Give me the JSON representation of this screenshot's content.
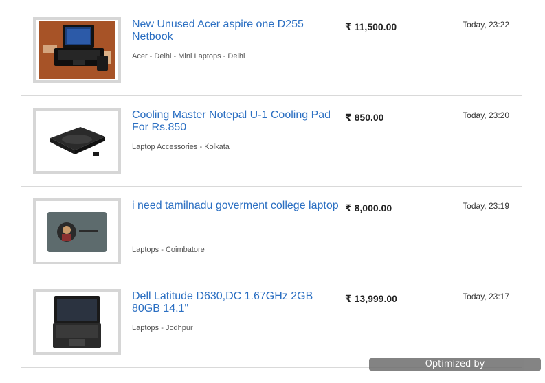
{
  "listings": [
    {
      "title": "New Unused Acer aspire one D255 Netbook",
      "meta": [
        "Acer",
        "Delhi",
        "Mini Laptops",
        "Delhi"
      ],
      "meta_separators": [
        " - ",
        " - ",
        " - "
      ],
      "price": "₹ 11,500.00",
      "time": "Today, 23:22"
    },
    {
      "title": "Cooling Master Notepal U-1 Cooling Pad For Rs.850",
      "meta": [
        "Laptop Accessories",
        "Kolkata"
      ],
      "meta_separators": [
        " - "
      ],
      "price": "₹ 850.00",
      "time": "Today, 23:20"
    },
    {
      "title": "i need tamilnadu goverment college laptop",
      "meta": [
        "Laptops",
        "Coimbatore"
      ],
      "meta_separators": [
        " - "
      ],
      "price": "₹ 8,000.00",
      "time": "Today, 23:19"
    },
    {
      "title": "Dell Latitude D630,DC 1.67GHz 2GB 80GB 14.1\"",
      "meta": [
        "Laptops",
        "Jodhpur"
      ],
      "meta_separators": [
        " - "
      ],
      "price": "₹ 13,999.00",
      "time": "Today, 23:17"
    }
  ],
  "watermark": "Optimized by www.ImageOptimizer.net",
  "colors": {
    "title_link": "#2b6fc2",
    "border": "#d9d9d9",
    "thumb_border": "#d6d6d6"
  }
}
